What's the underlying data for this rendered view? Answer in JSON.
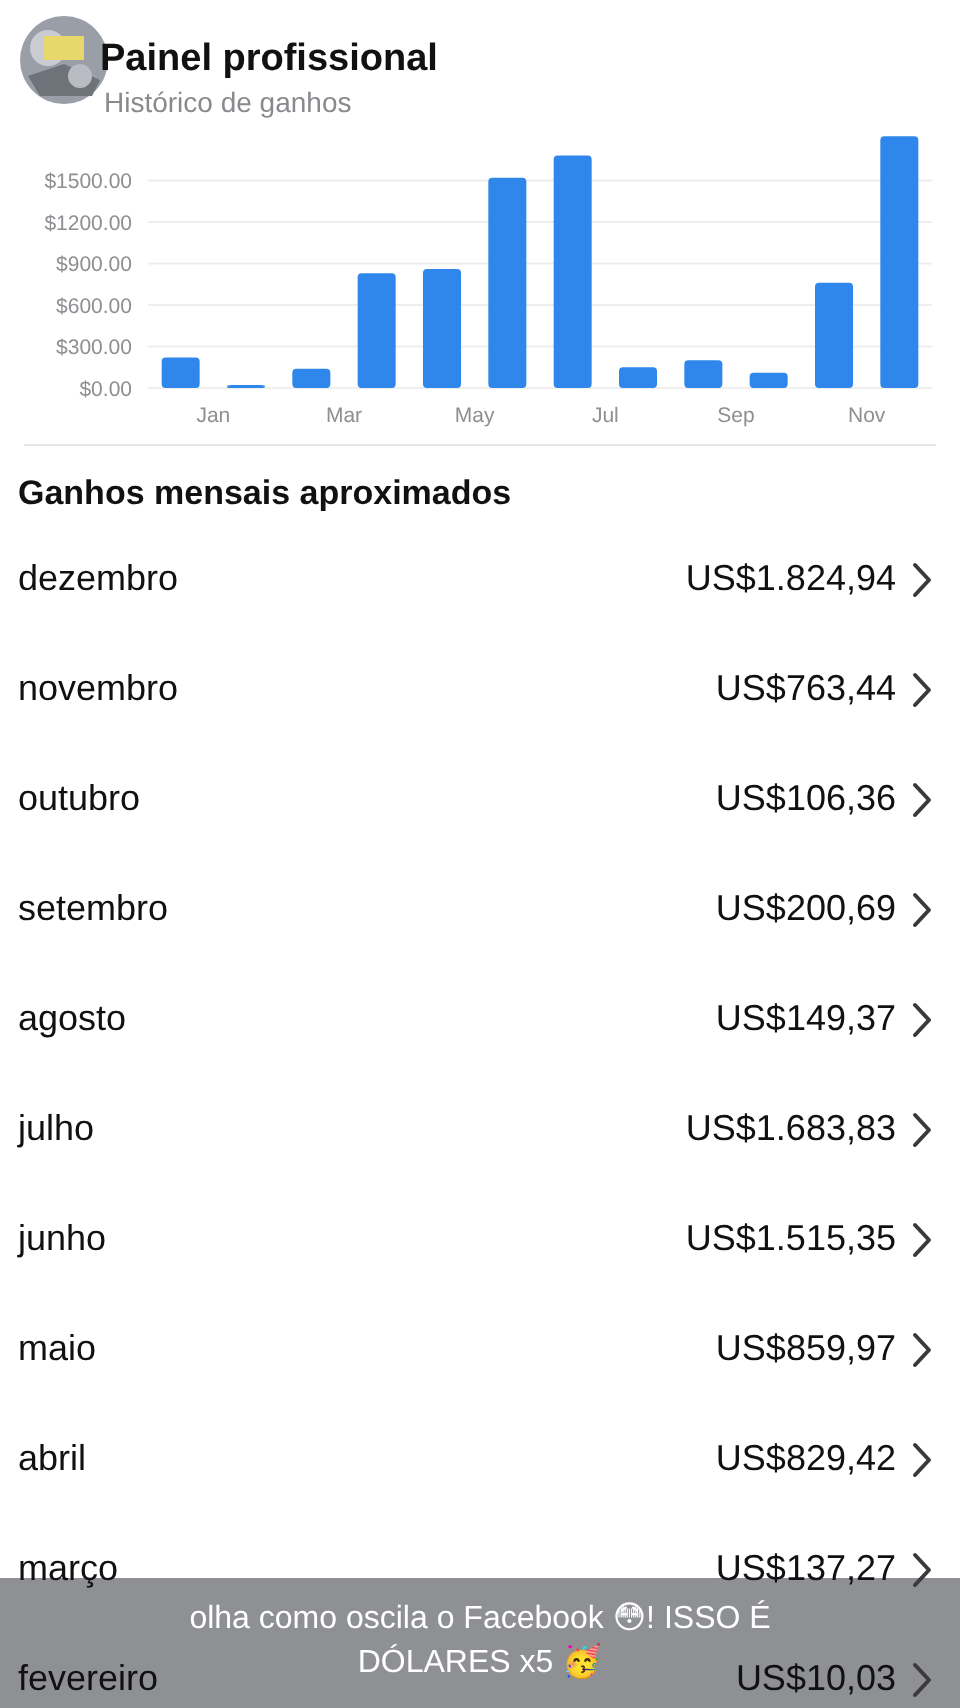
{
  "header": {
    "title": "Painel profissional",
    "subtitle": "Histórico de ganhos"
  },
  "chart_data": {
    "type": "bar",
    "categories": [
      "Jan",
      null,
      "Mar",
      null,
      "May",
      null,
      "Jul",
      null,
      "Sep",
      null,
      "Nov",
      null
    ],
    "series": [
      {
        "color": "#2f86eb",
        "values": [
          220,
          10,
          140,
          830,
          860,
          1520,
          1680,
          150,
          200,
          110,
          760,
          1820
        ]
      }
    ],
    "ylim": [
      0,
      1850
    ],
    "grid": true,
    "yticks": [
      {
        "value": 0,
        "label": "$0.00"
      },
      {
        "value": 300,
        "label": "$300.00"
      },
      {
        "value": 600,
        "label": "$600.00"
      },
      {
        "value": 900,
        "label": "$900.00"
      },
      {
        "value": 1200,
        "label": "$1200.00"
      },
      {
        "value": 1500,
        "label": "$1500.00"
      }
    ]
  },
  "section_title": "Ganhos mensais aproximados",
  "months": [
    {
      "name": "dezembro",
      "amount": "US$1.824,94"
    },
    {
      "name": "novembro",
      "amount": "US$763,44"
    },
    {
      "name": "outubro",
      "amount": "US$106,36"
    },
    {
      "name": "setembro",
      "amount": "US$200,69"
    },
    {
      "name": "agosto",
      "amount": "US$149,37"
    },
    {
      "name": "julho",
      "amount": "US$1.683,83"
    },
    {
      "name": "junho",
      "amount": "US$1.515,35"
    },
    {
      "name": "maio",
      "amount": "US$859,97"
    },
    {
      "name": "abril",
      "amount": "US$829,42"
    },
    {
      "name": "março",
      "amount": "US$137,27"
    },
    {
      "name": "fevereiro",
      "amount": "US$10,03"
    }
  ],
  "caption": "olha como oscila o Facebook 😳! ISSO É DÓLARES x5 🥳"
}
